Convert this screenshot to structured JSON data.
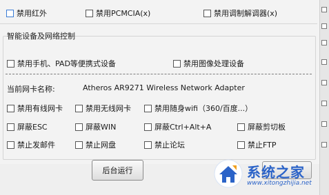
{
  "top_options": [
    {
      "label": "禁用红外",
      "checked": false,
      "highlight": true
    },
    {
      "label": "禁用PCMCIA(x)",
      "checked": false
    },
    {
      "label": "禁用调制解调器(x)",
      "checked": false
    }
  ],
  "smart_group": {
    "title": "智能设备及网络控制",
    "options": [
      {
        "label": "禁用手机、PAD等便携式设备",
        "checked": false
      },
      {
        "label": "禁用图像处理设备",
        "checked": false
      }
    ]
  },
  "network": {
    "adapter_label": "当前网卡名称:",
    "adapter_value": "Atheros AR9271 Wireless Network Adapter",
    "options": [
      {
        "label": "禁用有线网卡",
        "checked": false
      },
      {
        "label": "禁用无线网卡",
        "checked": false
      },
      {
        "label": "禁用随身wifi（360/百度...）",
        "checked": false
      },
      {
        "label": "屏蔽ESC",
        "checked": false
      },
      {
        "label": "屏蔽WIN",
        "checked": false
      },
      {
        "label": "屏蔽Ctrl+Alt+A",
        "checked": false
      },
      {
        "label": "屏蔽剪切板",
        "checked": false
      },
      {
        "label": "禁止发邮件",
        "checked": false
      },
      {
        "label": "禁止网盘",
        "checked": false
      },
      {
        "label": "禁止论坛",
        "checked": false
      },
      {
        "label": "禁止FTP",
        "checked": false
      }
    ]
  },
  "actions": {
    "background_run": "后台运行"
  },
  "watermark": {
    "text": "系统之家",
    "url": "www.xitongzhijia.net"
  },
  "colors": {
    "watermark": "#2b63c8",
    "highlight_border": "#3a7bd5"
  }
}
